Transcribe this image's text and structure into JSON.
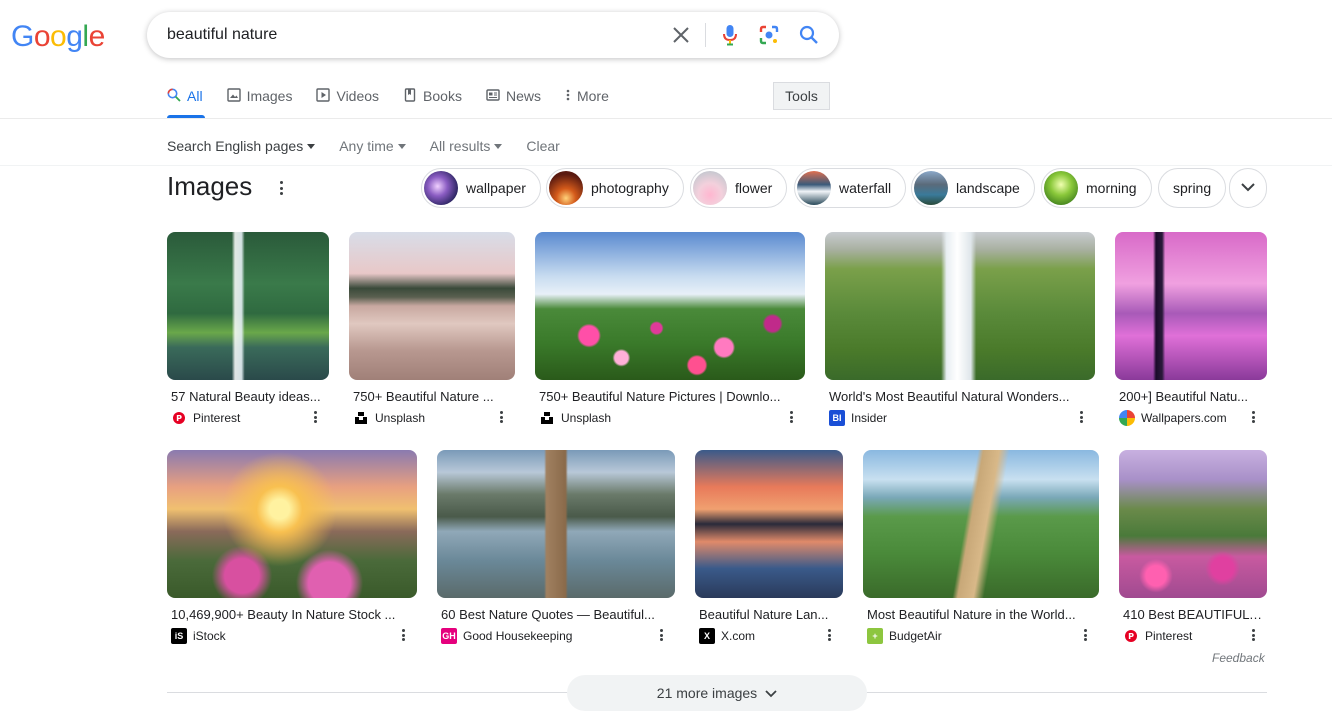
{
  "header": {
    "logo_letters": [
      "G",
      "o",
      "o",
      "g",
      "l",
      "e"
    ],
    "logo_colors": [
      "#4285f4",
      "#ea4335",
      "#fbbc05",
      "#4285f4",
      "#34a853",
      "#ea4335"
    ],
    "search_query": "beautiful nature"
  },
  "tabs": [
    {
      "label": "All",
      "icon": "search-icon"
    },
    {
      "label": "Images",
      "icon": "image-icon"
    },
    {
      "label": "Videos",
      "icon": "play-icon"
    },
    {
      "label": "Books",
      "icon": "book-icon"
    },
    {
      "label": "News",
      "icon": "news-icon"
    },
    {
      "label": "More",
      "icon": "kebab-icon"
    }
  ],
  "tools_label": "Tools",
  "filters": [
    "Search English pages",
    "Any time",
    "All results",
    "Clear"
  ],
  "images_heading": "Images",
  "chips": [
    "wallpaper",
    "photography",
    "flower",
    "waterfall",
    "landscape",
    "morning",
    "spring"
  ],
  "cards": [
    {
      "title": "57 Natural Beauty ideas...",
      "source": "Pinterest"
    },
    {
      "title": "750+ Beautiful Nature ...",
      "source": "Unsplash"
    },
    {
      "title": "750+ Beautiful Nature Pictures | Downlo...",
      "source": "Unsplash"
    },
    {
      "title": "World's Most Beautiful Natural Wonders...",
      "source": "Insider"
    },
    {
      "title": "200+] Beautiful Natu...",
      "source": "Wallpapers.com"
    },
    {
      "title": "10,469,900+ Beauty In Nature Stock ...",
      "source": "iStock"
    },
    {
      "title": "60 Best Nature Quotes — Beautiful...",
      "source": "Good Housekeeping"
    },
    {
      "title": "Beautiful Nature Lan...",
      "source": "X.com"
    },
    {
      "title": "Most Beautiful Nature in the World...",
      "source": "BudgetAir"
    },
    {
      "title": "410 Best BEAUTIFUL ...",
      "source": "Pinterest"
    }
  ],
  "favicons": {
    "Pinterest": {
      "text": "P",
      "color": "#e60023"
    },
    "Unsplash": {
      "text": "",
      "color": "#000000"
    },
    "Insider": {
      "text": "BI",
      "color": "#1a4fd6"
    },
    "Wallpapers.com": {
      "text": "",
      "color": "#ffffff"
    },
    "iStock": {
      "text": "iS",
      "color": "#000000"
    },
    "Good Housekeeping": {
      "text": "GH",
      "color": "#e5007d"
    },
    "X.com": {
      "text": "X",
      "color": "#000000"
    },
    "BudgetAir": {
      "text": "+",
      "color": "#8dc63f"
    }
  },
  "feedback_label": "Feedback",
  "more_images_label": "21 more images",
  "accent_color": "#1a73e8"
}
